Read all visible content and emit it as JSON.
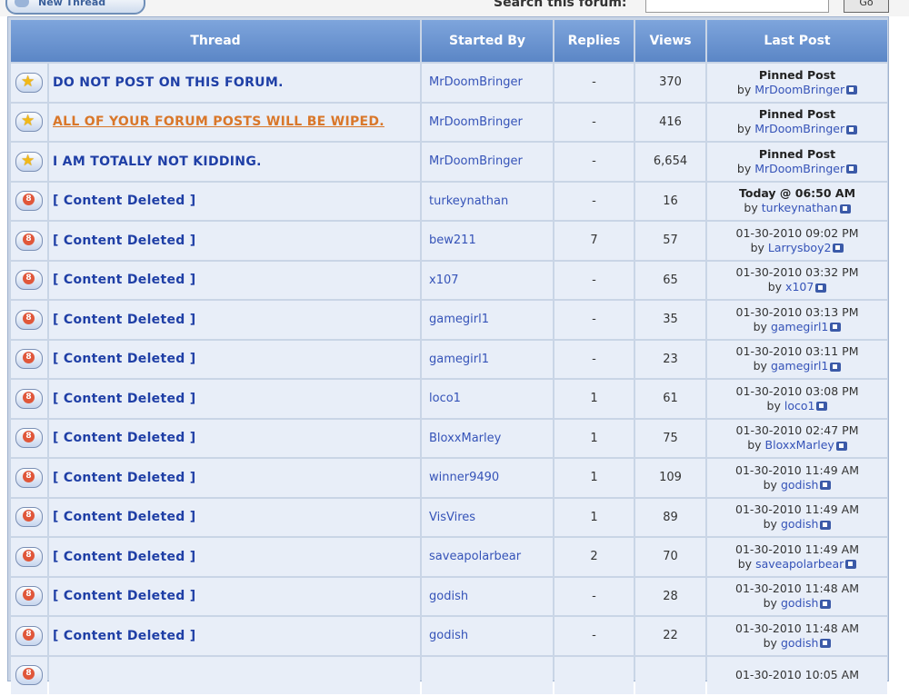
{
  "toolbar": {
    "new_thread_label": "New Thread",
    "search_label": "Search this forum:",
    "search_value": "",
    "go_label": "Go"
  },
  "table": {
    "headers": {
      "thread": "Thread",
      "started_by": "Started By",
      "replies": "Replies",
      "views": "Views",
      "last_post": "Last Post"
    },
    "rows": [
      {
        "icon": "sticky-star-icon",
        "title": "DO NOT POST ON THIS FORUM.",
        "starter": "MrDoomBringer",
        "replies": "-",
        "views": "370",
        "lp_line1": "Pinned Post",
        "lp_by": "by",
        "lp_user": "MrDoomBringer"
      },
      {
        "icon": "sticky-star-icon",
        "title": "ALL OF YOUR FORUM POSTS WILL BE WIPED.",
        "starter": "MrDoomBringer",
        "replies": "-",
        "views": "416",
        "lp_line1": "Pinned Post",
        "lp_by": "by",
        "lp_user": "MrDoomBringer"
      },
      {
        "icon": "sticky-star-icon",
        "title": "I AM TOTALLY NOT KIDDING.",
        "starter": "MrDoomBringer",
        "replies": "-",
        "views": "6,654",
        "lp_line1": "Pinned Post",
        "lp_by": "by",
        "lp_user": "MrDoomBringer"
      },
      {
        "icon": "locked-icon",
        "title": "[ Content Deleted ]",
        "starter": "turkeynathan",
        "replies": "-",
        "views": "16",
        "lp_line1": "Today @ 06:50 AM",
        "lp_by": "by",
        "lp_user": "turkeynathan"
      },
      {
        "icon": "locked-icon",
        "title": "[ Content Deleted ]",
        "starter": "bew211",
        "replies": "7",
        "views": "57",
        "lp_line1": "01-30-2010 09:02 PM",
        "lp_by": "by",
        "lp_user": "Larrysboy2"
      },
      {
        "icon": "locked-icon",
        "title": "[ Content Deleted ]",
        "starter": "x107",
        "replies": "-",
        "views": "65",
        "lp_line1": "01-30-2010 03:32 PM",
        "lp_by": "by",
        "lp_user": "x107"
      },
      {
        "icon": "locked-icon",
        "title": "[ Content Deleted ]",
        "starter": "gamegirl1",
        "replies": "-",
        "views": "35",
        "lp_line1": "01-30-2010 03:13 PM",
        "lp_by": "by",
        "lp_user": "gamegirl1"
      },
      {
        "icon": "locked-icon",
        "title": "[ Content Deleted ]",
        "starter": "gamegirl1",
        "replies": "-",
        "views": "23",
        "lp_line1": "01-30-2010 03:11 PM",
        "lp_by": "by",
        "lp_user": "gamegirl1"
      },
      {
        "icon": "locked-icon",
        "title": "[ Content Deleted ]",
        "starter": "loco1",
        "replies": "1",
        "views": "61",
        "lp_line1": "01-30-2010 03:08 PM",
        "lp_by": "by",
        "lp_user": "loco1"
      },
      {
        "icon": "locked-icon",
        "title": "[ Content Deleted ]",
        "starter": "BloxxMarley",
        "replies": "1",
        "views": "75",
        "lp_line1": "01-30-2010 02:47 PM",
        "lp_by": "by",
        "lp_user": "BloxxMarley"
      },
      {
        "icon": "locked-icon",
        "title": "[ Content Deleted ]",
        "starter": "winner9490",
        "replies": "1",
        "views": "109",
        "lp_line1": "01-30-2010 11:49 AM",
        "lp_by": "by",
        "lp_user": "godish"
      },
      {
        "icon": "locked-icon",
        "title": "[ Content Deleted ]",
        "starter": "VisVires",
        "replies": "1",
        "views": "89",
        "lp_line1": "01-30-2010 11:49 AM",
        "lp_by": "by",
        "lp_user": "godish"
      },
      {
        "icon": "locked-icon",
        "title": "[ Content Deleted ]",
        "starter": "saveapolarbear",
        "replies": "2",
        "views": "70",
        "lp_line1": "01-30-2010 11:49 AM",
        "lp_by": "by",
        "lp_user": "saveapolarbear"
      },
      {
        "icon": "locked-icon",
        "title": "[ Content Deleted ]",
        "starter": "godish",
        "replies": "-",
        "views": "28",
        "lp_line1": "01-30-2010 11:48 AM",
        "lp_by": "by",
        "lp_user": "godish"
      },
      {
        "icon": "locked-icon",
        "title": "[ Content Deleted ]",
        "starter": "godish",
        "replies": "-",
        "views": "22",
        "lp_line1": "01-30-2010 11:48 AM",
        "lp_by": "by",
        "lp_user": "godish"
      },
      {
        "icon": "locked-icon",
        "title": "",
        "starter": "",
        "replies": "",
        "views": "",
        "lp_line1": "01-30-2010 10:05 AM",
        "lp_by": "",
        "lp_user": ""
      }
    ]
  }
}
